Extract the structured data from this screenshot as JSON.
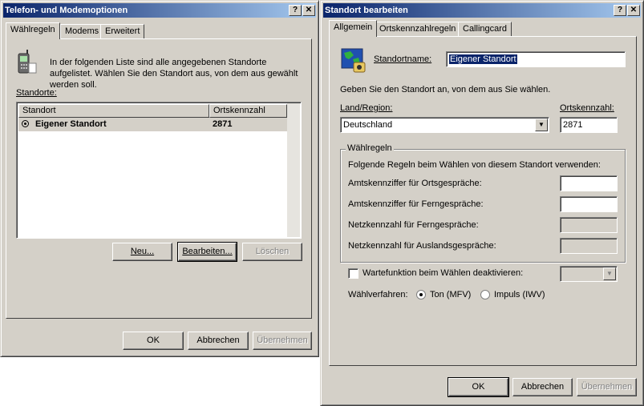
{
  "left": {
    "title": "Telefon- und Modemoptionen",
    "tabs": [
      "Wählregeln",
      "Modems",
      "Erweitert"
    ],
    "intro": "In der folgenden Liste sind alle angegebenen Standorte aufgelistet. Wählen Sie den Standort aus, von dem aus gewählt werden soll.",
    "list_label": "Standorte:",
    "columns": [
      "Standort",
      "Ortskennzahl"
    ],
    "rows": [
      {
        "name": "Eigener Standort",
        "code": "2871"
      }
    ],
    "btn_new": "Neu...",
    "btn_edit": "Bearbeiten...",
    "btn_delete": "Löschen",
    "btn_ok": "OK",
    "btn_cancel": "Abbrechen",
    "btn_apply": "Übernehmen"
  },
  "right": {
    "title": "Standort bearbeiten",
    "tabs": [
      "Allgemein",
      "Ortskennzahlregeln",
      "Callingcard"
    ],
    "name_label": "Standortname:",
    "name_value": "Eigener Standort",
    "hint": "Geben Sie den Standort an, von dem aus Sie wählen.",
    "country_label": "Land/Region:",
    "country_value": "Deutschland",
    "area_label": "Ortskennzahl:",
    "area_value": "2871",
    "group_title": "Wählregeln",
    "group_desc": "Folgende Regeln beim Wählen von diesem Standort verwenden:",
    "rule1": "Amtskennziffer für Ortsgespräche:",
    "rule2": "Amtskennziffer für Ferngespräche:",
    "rule3": "Netzkennzahl für Ferngespräche:",
    "rule4": "Netzkennzahl für Auslandsgespräche:",
    "wait_label": "Wartefunktion beim Wählen deaktivieren:",
    "method_label": "Wählverfahren:",
    "tone_label": "Ton (MFV)",
    "pulse_label": "Impuls (IWV)",
    "btn_ok": "OK",
    "btn_cancel": "Abbrechen",
    "btn_apply": "Übernehmen"
  },
  "titlebar_buttons": {
    "help": "?",
    "close": "✕"
  },
  "colors": {
    "title_start": "#0a246a",
    "title_end": "#a6caf0",
    "face": "#d4d0c8",
    "selection": "#0a246a"
  }
}
